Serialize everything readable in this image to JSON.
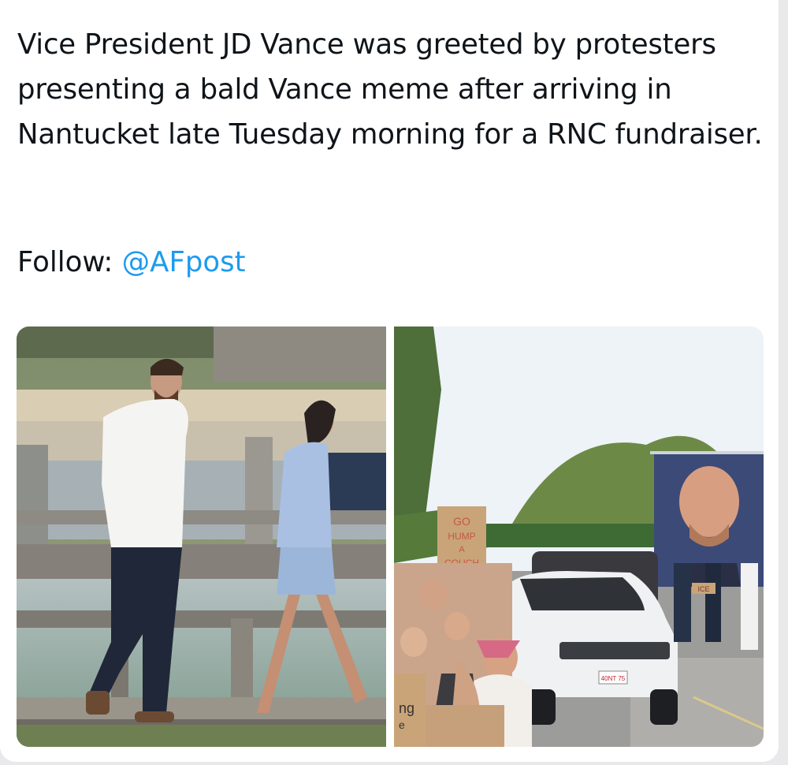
{
  "post": {
    "text": "Vice President JD Vance was greeted by protesters presenting a bald Vance meme after arriving in Nantucket late Tuesday morning for a RNC fundraiser.",
    "follow_label": "Follow:",
    "handle": "@AFpost"
  },
  "media": {
    "signs": {
      "go_hump": [
        "GO",
        "HUMP",
        "A",
        "COUCH"
      ],
      "ice": "ICE",
      "plate": "40NT 75",
      "partial": [
        "ng",
        "e"
      ]
    }
  },
  "colors": {
    "link": "#1d9bf0",
    "text": "#0f1419"
  }
}
